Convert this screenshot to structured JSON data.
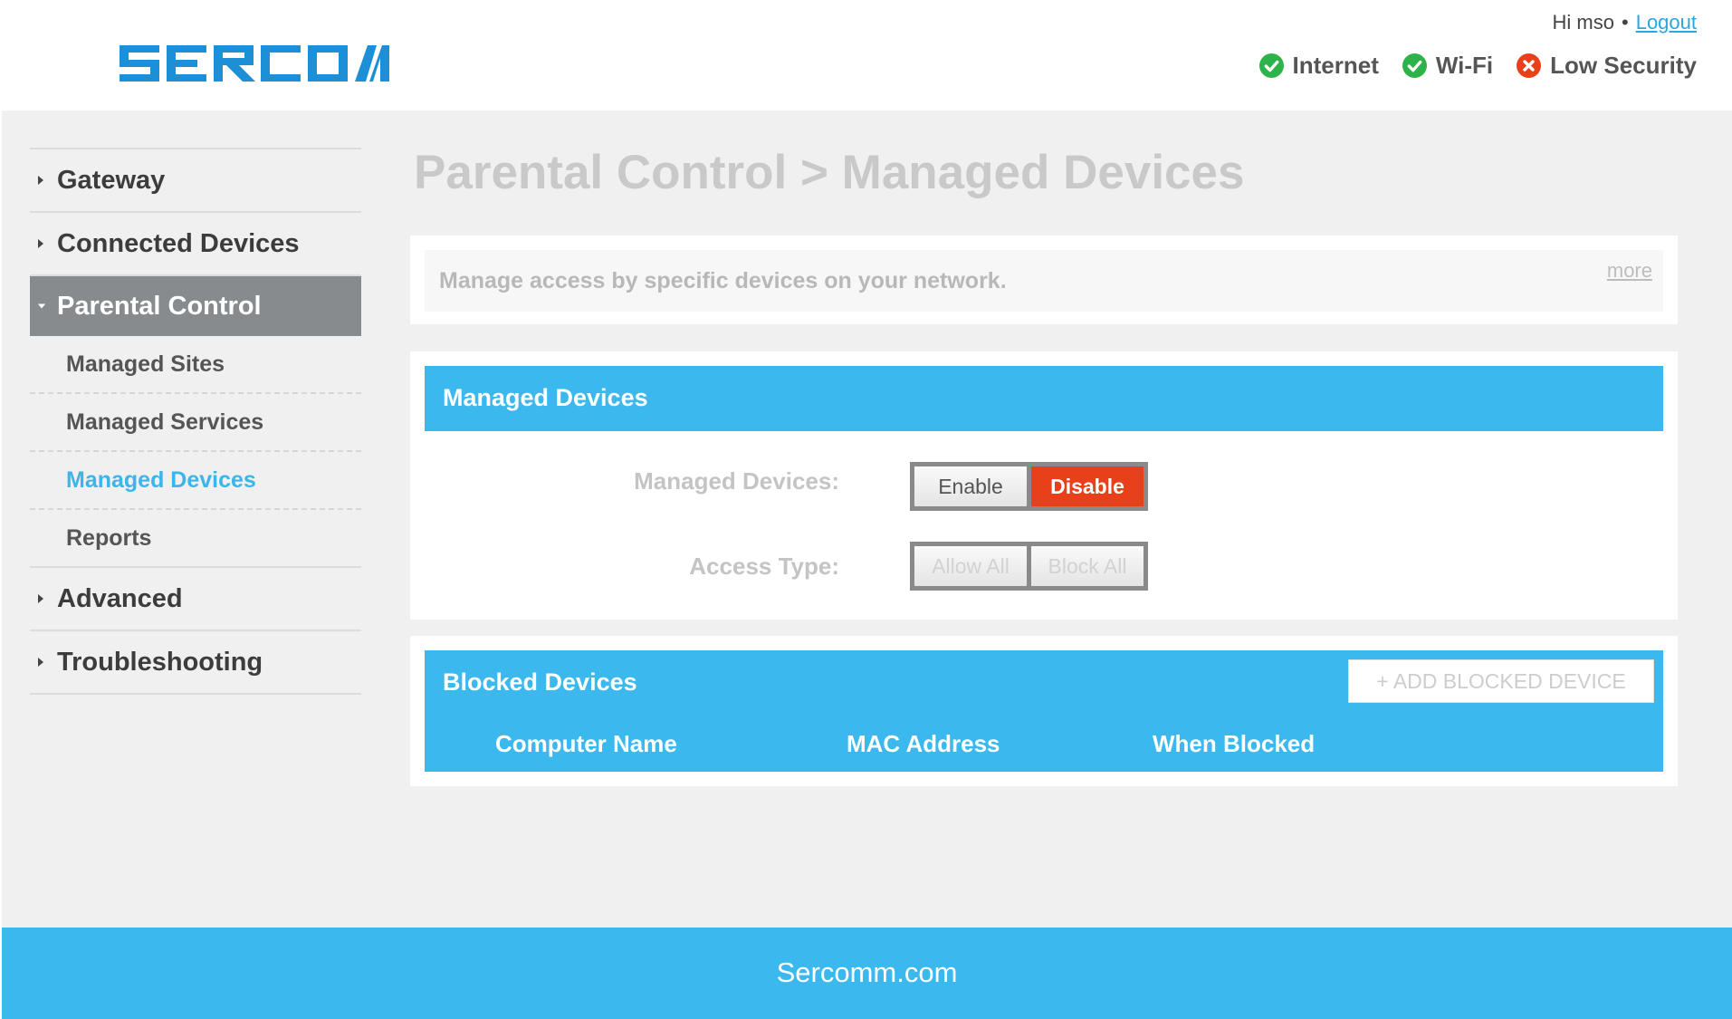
{
  "header": {
    "logo_text": "SERCOMM",
    "greeting": "Hi mso",
    "separator": "•",
    "logout_label": "Logout",
    "status": [
      {
        "label": "Internet",
        "state": "ok",
        "icon": "check-circle-icon",
        "color": "#2db34a"
      },
      {
        "label": "Wi-Fi",
        "state": "ok",
        "icon": "check-circle-icon",
        "color": "#2db34a"
      },
      {
        "label": "Low Security",
        "state": "warning",
        "icon": "x-circle-icon",
        "color": "#e8401a"
      }
    ]
  },
  "sidebar": {
    "items": [
      {
        "label": "Gateway",
        "expanded": false
      },
      {
        "label": "Connected Devices",
        "expanded": false
      },
      {
        "label": "Parental Control",
        "expanded": true,
        "children": [
          {
            "label": "Managed Sites"
          },
          {
            "label": "Managed Services"
          },
          {
            "label": "Managed Devices",
            "current": true
          },
          {
            "label": "Reports"
          }
        ]
      },
      {
        "label": "Advanced",
        "expanded": false
      },
      {
        "label": "Troubleshooting",
        "expanded": false
      }
    ]
  },
  "main": {
    "title": "Parental Control > Managed Devices",
    "description": "Manage access by specific devices on your network.",
    "more_label": "more",
    "managed_devices_section": {
      "title": "Managed Devices",
      "managed_label": "Managed Devices:",
      "enable_label": "Enable",
      "disable_label": "Disable",
      "selected": "Disable",
      "access_label": "Access Type:",
      "allow_all_label": "Allow All",
      "block_all_label": "Block All"
    },
    "blocked_section": {
      "title": "Blocked Devices",
      "add_button_label": "+ ADD BLOCKED DEVICE",
      "columns": [
        "Computer Name",
        "MAC Address",
        "When Blocked"
      ]
    }
  },
  "footer": {
    "text": "Sercomm.com"
  },
  "colors": {
    "accent": "#3bb8ee",
    "active_nav": "#878b8e",
    "danger": "#e8401a",
    "ok": "#2db34a"
  }
}
